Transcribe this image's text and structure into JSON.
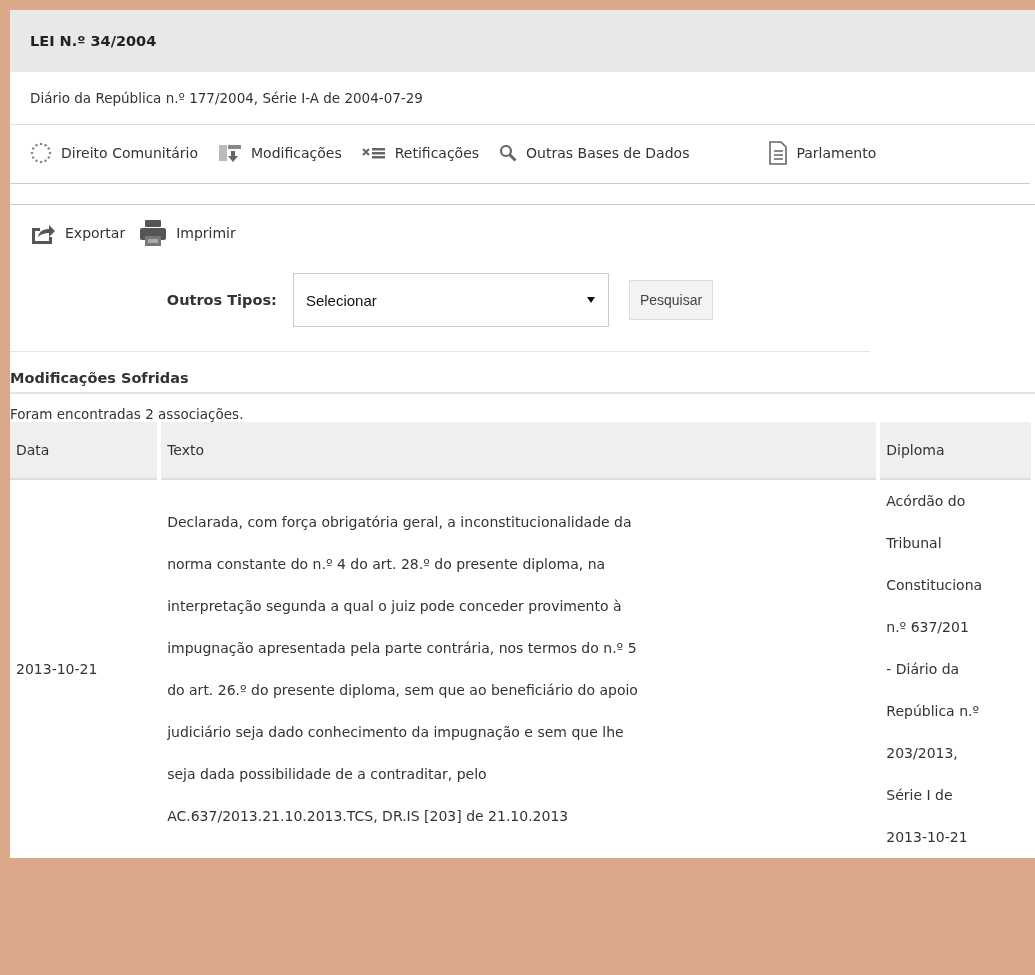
{
  "title": "LEI N.º 34/2004",
  "subtitle": "Diário da República n.º 177/2004, Série I-A de 2004-07-29",
  "links": [
    {
      "kind": "eu",
      "label": "Direito Comunitário"
    },
    {
      "kind": "mods",
      "label": "Modificações"
    },
    {
      "kind": "retif",
      "label": "Retificações"
    },
    {
      "kind": "search",
      "label": "Outras Bases de Dados"
    },
    {
      "kind": "doc",
      "label": "Parlamento"
    }
  ],
  "actions": [
    {
      "kind": "export",
      "label": "Exportar"
    },
    {
      "kind": "print",
      "label": "Imprimir"
    }
  ],
  "filter": {
    "label": "Outros Tipos:",
    "value": "Selecionar",
    "button": "Pesquisar"
  },
  "section": {
    "heading": "Modificações Sofridas",
    "count": "Foram encontradas 2 associações."
  },
  "table": {
    "columns": [
      "Data",
      "Texto",
      "Diploma"
    ],
    "rows": [
      {
        "date": "2013-10-21",
        "text_lines": [
          "Declarada, com força obrigatória geral, a inconstitucionalidade da",
          "norma constante do n.º 4 do art. 28.º do presente diploma, na",
          "interpretação segunda a qual o juiz pode conceder provimento à",
          "impugnação apresentada pela parte contrária, nos termos do n.º 5",
          "do art. 26.º do presente diploma, sem que ao beneficiário do apoio",
          "judiciário seja dado conhecimento da impugnação e sem que lhe",
          "seja dada possibilidade de a contraditar, pelo",
          "AC.637/2013.21.10.2013.TCS, DR.IS [203] de 21.10.2013"
        ],
        "diploma_lines": [
          "Acórdão do",
          "Tribunal",
          "Constituciona",
          "n.º 637/201",
          "- Diário da",
          "República n.º",
          "203/2013,",
          "Série I de",
          "2013-10-21"
        ]
      }
    ]
  }
}
